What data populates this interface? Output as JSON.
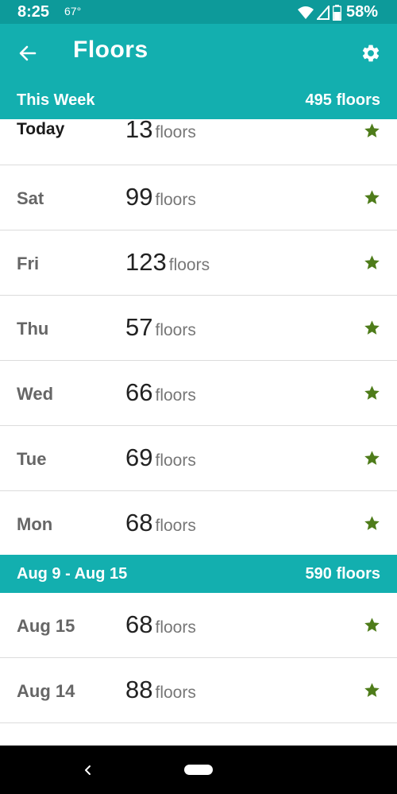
{
  "status_bar": {
    "time": "8:25",
    "temperature": "67°",
    "battery": "58%"
  },
  "app_bar": {
    "title": "Floors",
    "back_icon": "arrow-left-icon",
    "settings_icon": "gear-icon"
  },
  "colors": {
    "status_bar": "#0d9a9a",
    "app_bar": "#13afaf",
    "section_header": "#13afaf",
    "star": "#4e7c1a"
  },
  "sections": [
    {
      "label": "This Week",
      "total": "495 floors",
      "rows": [
        {
          "day": "Today",
          "count": "13",
          "unit": "floors",
          "goal_met": true
        },
        {
          "day": "Sat",
          "count": "99",
          "unit": "floors",
          "goal_met": true
        },
        {
          "day": "Fri",
          "count": "123",
          "unit": "floors",
          "goal_met": true
        },
        {
          "day": "Thu",
          "count": "57",
          "unit": "floors",
          "goal_met": true
        },
        {
          "day": "Wed",
          "count": "66",
          "unit": "floors",
          "goal_met": true
        },
        {
          "day": "Tue",
          "count": "69",
          "unit": "floors",
          "goal_met": true
        },
        {
          "day": "Mon",
          "count": "68",
          "unit": "floors",
          "goal_met": true
        }
      ]
    },
    {
      "label": "Aug 9 - Aug 15",
      "total": "590 floors",
      "rows": [
        {
          "day": "Aug 15",
          "count": "68",
          "unit": "floors",
          "goal_met": true
        },
        {
          "day": "Aug 14",
          "count": "88",
          "unit": "floors",
          "goal_met": true
        }
      ]
    }
  ]
}
